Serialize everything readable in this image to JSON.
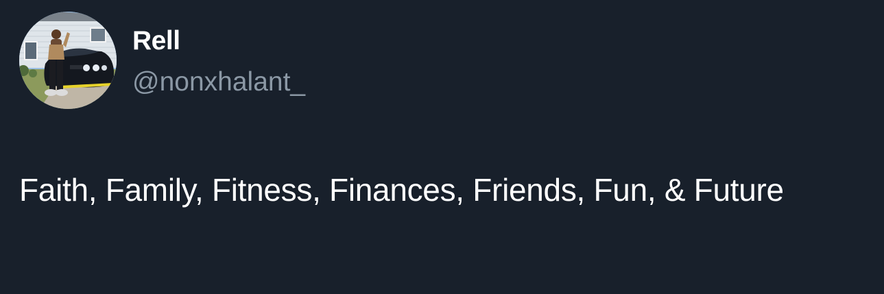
{
  "user": {
    "display_name": "Rell",
    "handle": "@nonxhalant_"
  },
  "tweet": {
    "text": "Faith, Family, Fitness, Finances, Friends, Fun, & Future"
  },
  "colors": {
    "background": "#18202b",
    "name": "#ffffff",
    "handle": "#8b98a5",
    "text": "#ffffff"
  }
}
